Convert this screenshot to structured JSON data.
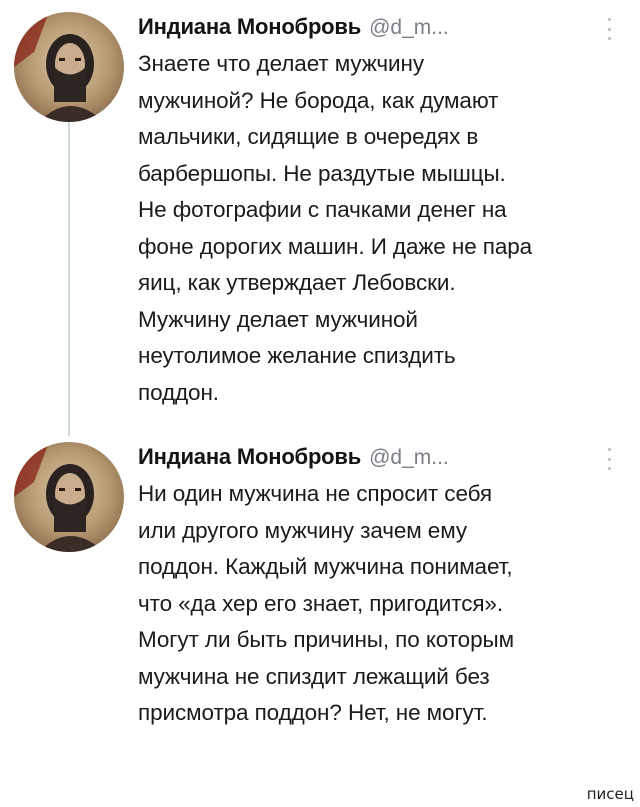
{
  "tweets": [
    {
      "author": "Индиана Монобровь",
      "handle": "@d_m...",
      "lines": [
        "Знаете что делает мужчину",
        "мужчиной? Не борода, как думают",
        "мальчики, сидящие в очередях в",
        "барбершопы. Не раздутые мышцы.",
        "Не фотографии с пачками денег на",
        "фоне дорогих машин. И даже не пара",
        "яиц, как утверждает Лебовски.",
        "Мужчину делает мужчиной",
        "неутолимое желание спиздить",
        "поддон."
      ],
      "icons": {
        "avatar": "avatar",
        "more": "more-vertical-icon"
      }
    },
    {
      "author": "Индиана Монобровь",
      "handle": "@d_m...",
      "lines": [
        "Ни один мужчина не спросит себя",
        "или другого мужчину зачем ему",
        "поддон. Каждый мужчина понимает,",
        "что «да хер его знает, пригодится».",
        "Могут ли быть причины, по которым",
        "мужчина не спиздит лежащий без",
        "присмотра поддон? Нет, не могут."
      ],
      "icons": {
        "avatar": "avatar",
        "more": "more-vertical-icon"
      }
    }
  ],
  "watermark": "писец",
  "colors": {
    "text": "#1b1b1b",
    "handle": "#7a7f86",
    "thread_line": "#cfd9de",
    "dots": "#b8bcc2"
  }
}
